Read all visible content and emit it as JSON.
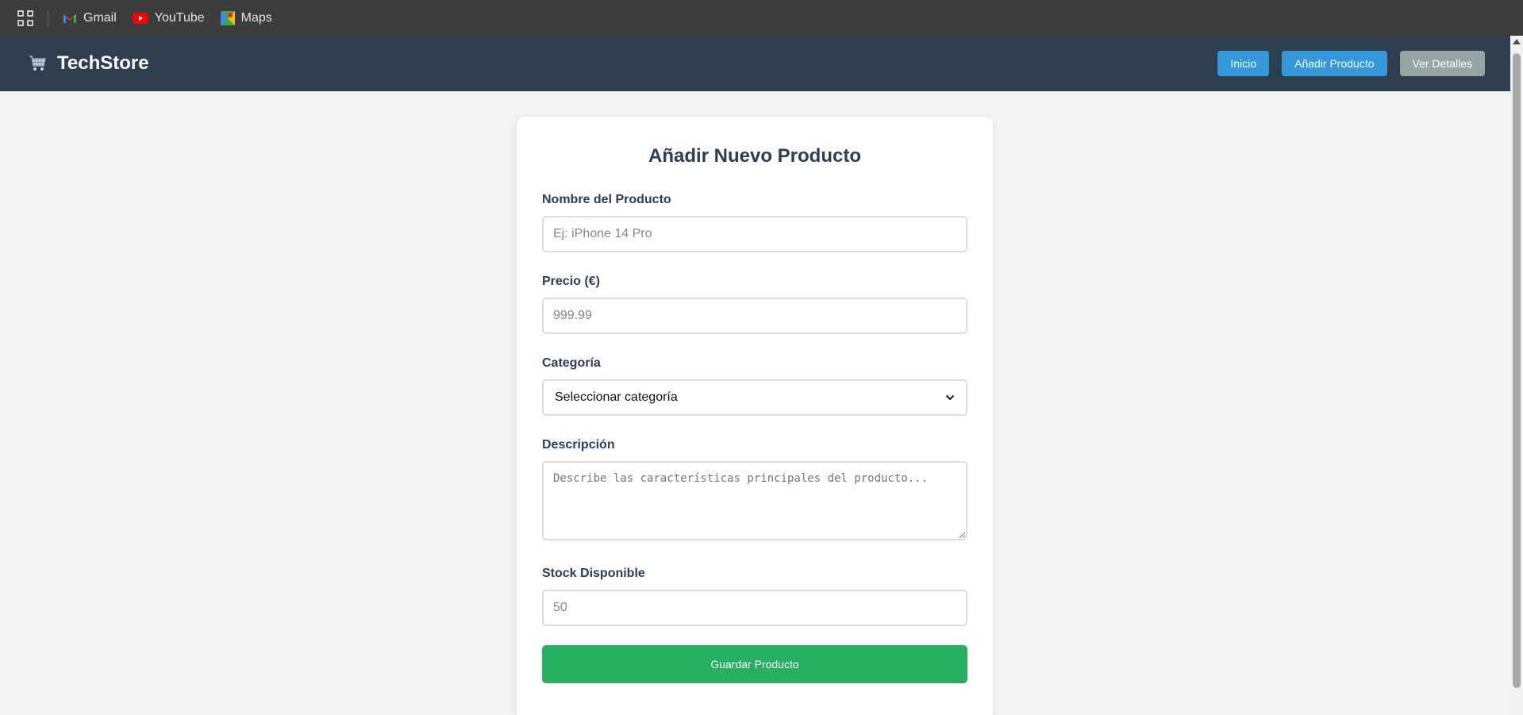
{
  "bookmarks": [
    {
      "label": "Gmail",
      "icon": "gmail-icon"
    },
    {
      "label": "YouTube",
      "icon": "youtube-icon"
    },
    {
      "label": "Maps",
      "icon": "maps-icon"
    }
  ],
  "navbar": {
    "brand": "TechStore",
    "brand_icon": "cart-icon",
    "buttons": {
      "home": "Inicio",
      "add_product": "Añadir Producto",
      "details": "Ver Detalles"
    }
  },
  "form": {
    "title": "Añadir Nuevo Producto",
    "name": {
      "label": "Nombre del Producto",
      "placeholder": "Ej: iPhone 14 Pro"
    },
    "price": {
      "label": "Precio (€)",
      "placeholder": "999.99"
    },
    "category": {
      "label": "Categoría",
      "selected": "Seleccionar categoría"
    },
    "description": {
      "label": "Descripción",
      "placeholder": "Describe las características principales del producto..."
    },
    "stock": {
      "label": "Stock Disponible",
      "placeholder": "50"
    },
    "submit": "Guardar Producto"
  },
  "colors": {
    "navbar": "#2c3e50",
    "primary": "#3498db",
    "secondary": "#95a5a6",
    "success": "#27ae60"
  }
}
